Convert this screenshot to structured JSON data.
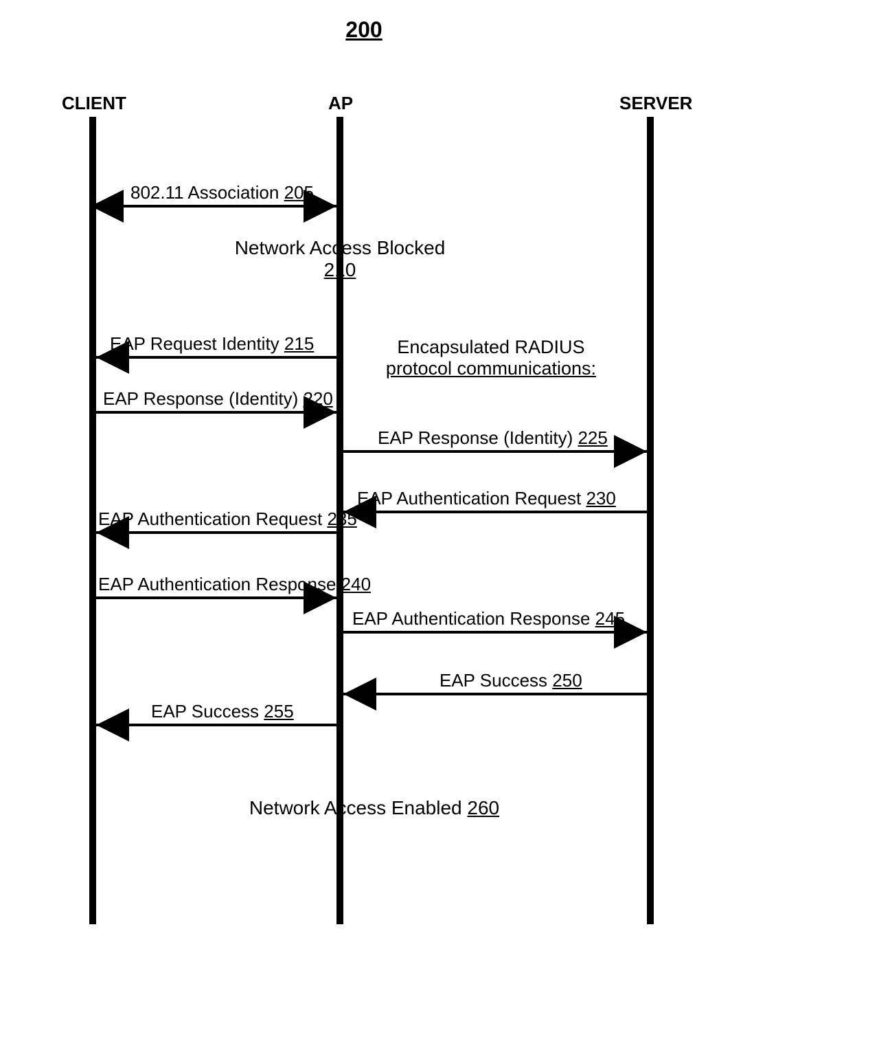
{
  "figure_number": "200",
  "actors": {
    "client": "CLIENT",
    "ap": "AP",
    "server": "SERVER"
  },
  "notes": {
    "blocked": {
      "text": "Network Access Blocked",
      "ref": "210"
    },
    "radius": {
      "line1": "Encapsulated RADIUS",
      "line2": "protocol communications:"
    },
    "enabled": {
      "text": "Network Access Enabled",
      "ref": "260"
    }
  },
  "messages": {
    "m205": {
      "text": "802.11 Association",
      "ref": "205"
    },
    "m215": {
      "text": "EAP Request Identity",
      "ref": "215"
    },
    "m220": {
      "text": "EAP Response (Identity)",
      "ref": "220"
    },
    "m225": {
      "text": "EAP Response (Identity)",
      "ref": "225"
    },
    "m230": {
      "text": "EAP Authentication Request",
      "ref": "230"
    },
    "m235": {
      "text": "EAP Authentication Request",
      "ref": "235"
    },
    "m240": {
      "text": "EAP Authentication Response",
      "ref": "240"
    },
    "m245": {
      "text": "EAP Authentication Response",
      "ref": "245"
    },
    "m250": {
      "text": "EAP Success",
      "ref": "250"
    },
    "m255": {
      "text": "EAP Success",
      "ref": "255"
    }
  }
}
